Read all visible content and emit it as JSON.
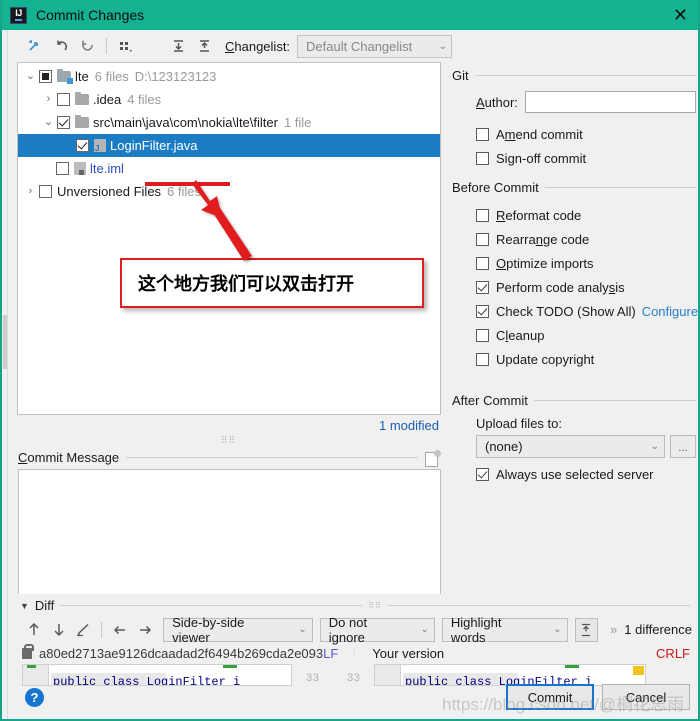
{
  "window": {
    "title": "Commit Changes",
    "logo_text": "IJ",
    "close_label": "✕"
  },
  "toolbar": {
    "icons": [
      {
        "name": "show-diff-icon",
        "glyph": "⇥"
      },
      {
        "name": "revert-icon",
        "glyph": "↺"
      },
      {
        "name": "refresh-icon",
        "glyph": "⟳"
      },
      {
        "name": "group-by-icon",
        "glyph": "⠿"
      },
      {
        "name": "expand-all-icon",
        "glyph": "⤓"
      },
      {
        "name": "collapse-all-icon",
        "glyph": "⤒"
      }
    ],
    "changelist_label": "Changelist:",
    "changelist_value": "Default Changelist"
  },
  "tree": {
    "rows": [
      {
        "indent": 0,
        "twisty": "⌄",
        "checkbox": "partial",
        "icon": "folder-blue-module",
        "name": "lte",
        "meta": "6 files",
        "path": "D:\\123123123",
        "selected": false,
        "link": false
      },
      {
        "indent": 1,
        "twisty": "›",
        "checkbox": "off",
        "icon": "folder",
        "name": ".idea",
        "meta": "4 files",
        "path": "",
        "selected": false,
        "link": false
      },
      {
        "indent": 1,
        "twisty": "⌄",
        "checkbox": "checked",
        "icon": "folder",
        "name": "src\\main\\java\\com\\nokia\\lte\\filter",
        "meta": "1 file",
        "path": "",
        "selected": false,
        "link": false
      },
      {
        "indent": 2,
        "twisty": "",
        "checkbox": "checked",
        "icon": "java-file",
        "name": "LoginFilter.java",
        "meta": "",
        "path": "",
        "selected": true,
        "link": false
      },
      {
        "indent": 1,
        "twisty": "",
        "checkbox": "off",
        "icon": "iml-file",
        "name": "lte.iml",
        "meta": "",
        "path": "",
        "selected": false,
        "link": true
      },
      {
        "indent": 0,
        "twisty": "›",
        "checkbox": "off",
        "icon": "none",
        "name": "Unversioned Files",
        "meta": "6 files",
        "path": "",
        "selected": false,
        "link": false
      }
    ],
    "modified_count": "1 modified"
  },
  "commit_message": {
    "label": "Commit Message",
    "label_mnemonic": "C",
    "value": "",
    "history_icon": "message-history-icon"
  },
  "right_panel": {
    "git": {
      "group_label": "Git",
      "author_label": "Author:",
      "author_mnemonic": "A",
      "author_value": "",
      "checkboxes": [
        {
          "label": "Amend commit",
          "mnemonic": "m",
          "checked": false,
          "name": "amend-commit"
        },
        {
          "label": "Sign-off commit",
          "mnemonic": "g",
          "checked": false,
          "name": "sign-off-commit"
        }
      ]
    },
    "before_commit": {
      "group_label": "Before Commit",
      "checkboxes": [
        {
          "label": "Reformat code",
          "mnemonic": "R",
          "checked": false,
          "name": "reformat-code"
        },
        {
          "label": "Rearrange code",
          "mnemonic": "n",
          "checked": false,
          "name": "rearrange-code"
        },
        {
          "label": "Optimize imports",
          "mnemonic": "O",
          "checked": false,
          "name": "optimize-imports"
        },
        {
          "label": "Perform code analysis",
          "mnemonic": "s",
          "checked": true,
          "name": "perform-code-analysis"
        },
        {
          "label": "Check TODO (Show All)",
          "mnemonic": "",
          "checked": true,
          "name": "check-todo",
          "link": "Configure"
        },
        {
          "label": "Cleanup",
          "mnemonic": "l",
          "checked": false,
          "name": "cleanup"
        },
        {
          "label": "Update copyright",
          "mnemonic": "",
          "checked": false,
          "name": "update-copyright"
        }
      ]
    },
    "after_commit": {
      "group_label": "After Commit",
      "upload_label": "Upload files to:",
      "upload_value": "(none)",
      "browse_label": "...",
      "always_use": {
        "label": "Always use selected server",
        "checked": true
      }
    }
  },
  "annotation": {
    "text": "这个地方我们可以双击打开",
    "color": "#e01b1b"
  },
  "diff": {
    "section_label": "Diff",
    "toolbar_icons": [
      {
        "name": "previous-difference-icon",
        "glyph": "↑"
      },
      {
        "name": "next-difference-icon",
        "glyph": "↓"
      },
      {
        "name": "edit-source-icon",
        "glyph": "✎"
      },
      {
        "name": "accept-left-icon",
        "glyph": "←"
      },
      {
        "name": "accept-right-icon",
        "glyph": "→"
      }
    ],
    "viewer_mode": "Side-by-side viewer",
    "ignore_mode": "Do not ignore",
    "highlight_mode": "Highlight words",
    "collapse_icon": "collapse-unchanged-icon",
    "more_glyph": "»",
    "difference_count": "1 difference",
    "left_revision": "a80ed2713ae9126dcaadad2f6494b269cda2e093",
    "left_line_ending": "LF",
    "right_title": "Your version",
    "right_line_ending": "CRLF",
    "left_code": "public class LoginFilter i",
    "right_code": "public class LoginFilter i",
    "left_lineno": "33",
    "right_lineno": "33"
  },
  "footer": {
    "help_label": "?",
    "commit_label": "Commit",
    "cancel_label": "Cancel"
  },
  "watermark": "https://blog.csdn.net/@桐花思雨"
}
